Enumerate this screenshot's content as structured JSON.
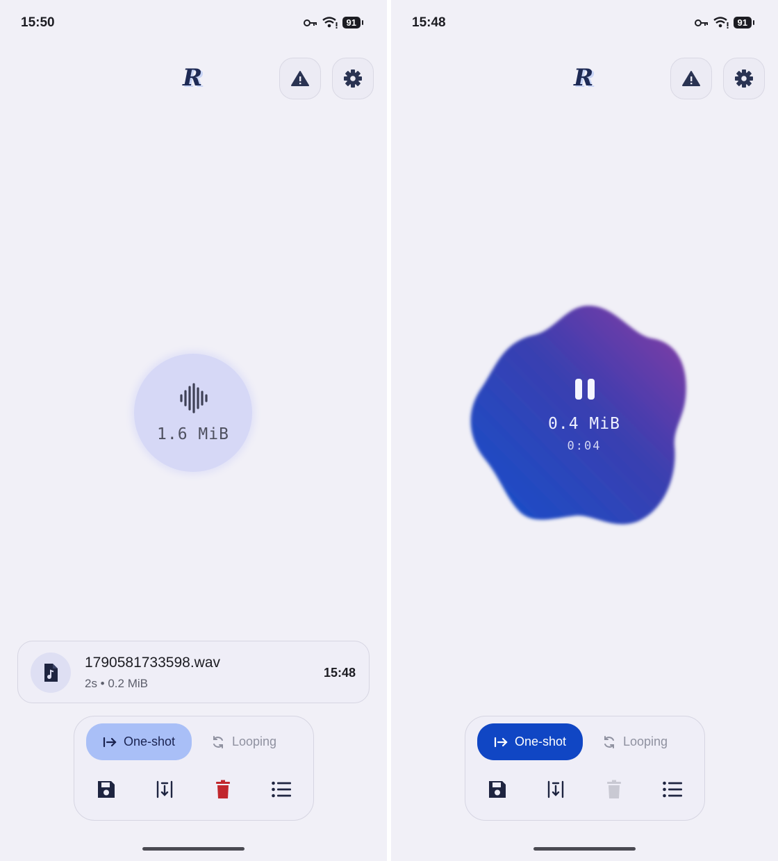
{
  "left": {
    "status": {
      "time": "15:50",
      "battery": "91"
    },
    "logo": "R",
    "recorder": {
      "size": "1.6 MiB"
    },
    "file": {
      "name": "1790581733598.wav",
      "meta": "2s • 0.2 MiB",
      "time": "15:48"
    },
    "modes": {
      "oneshot": "One-shot",
      "looping": "Looping",
      "selected": "oneshot"
    }
  },
  "right": {
    "status": {
      "time": "15:48",
      "battery": "91"
    },
    "logo": "R",
    "recorder": {
      "size": "0.4 MiB",
      "elapsed": "0:04"
    },
    "modes": {
      "oneshot": "One-shot",
      "looping": "Looping",
      "selected": "oneshot"
    }
  },
  "colors": {
    "background": "#f1f0f7",
    "accent_light": "#a9bff7",
    "accent_strong": "#1046c4",
    "delete_red": "#c1272d",
    "blob_gradient": [
      "#1a4fc9",
      "#7a3aa6"
    ]
  },
  "icons": [
    "key-icon",
    "wifi-icon",
    "warning-icon",
    "gear-icon",
    "waveform-icon",
    "pause-icon",
    "music-file-icon",
    "arrow-right-bar-icon",
    "loop-icon",
    "save-icon",
    "trim-icon",
    "delete-icon",
    "list-icon"
  ]
}
